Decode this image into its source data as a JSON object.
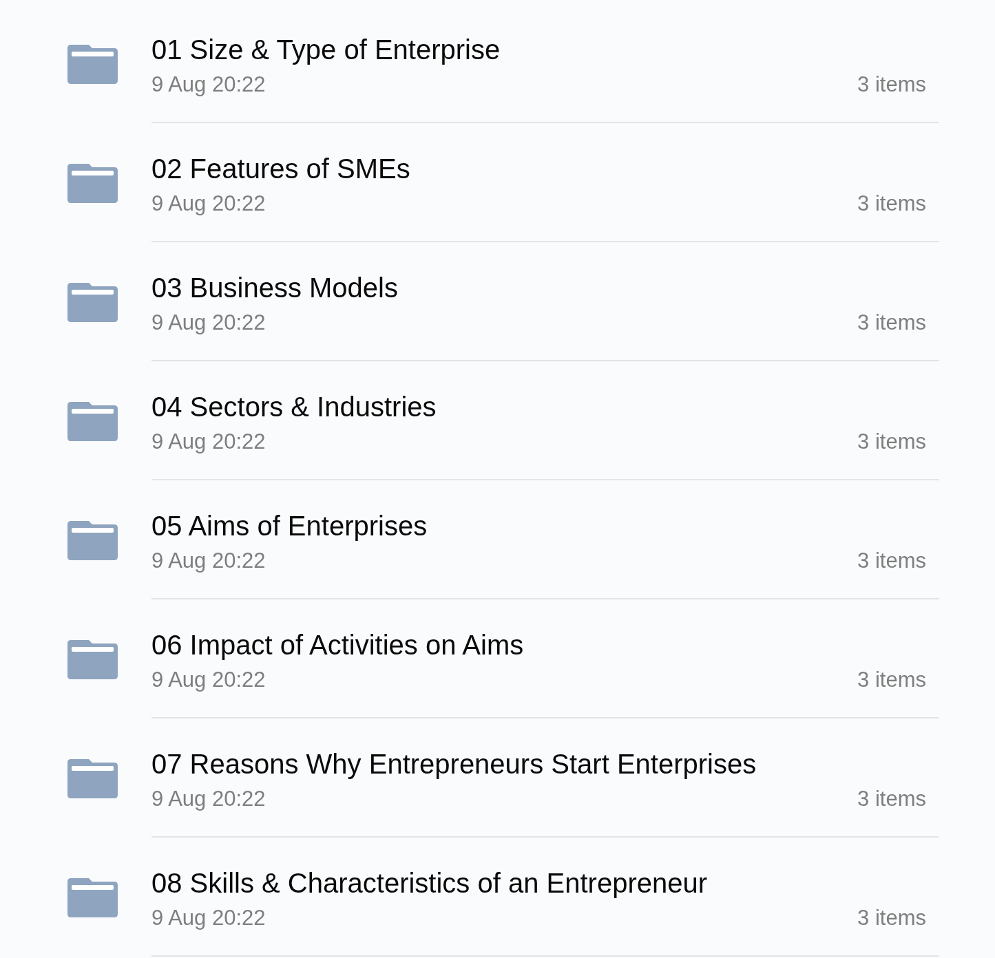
{
  "folders": [
    {
      "name": "01 Size & Type of Enterprise",
      "modified": "9 Aug 20:22",
      "count": "3 items"
    },
    {
      "name": "02 Features of SMEs",
      "modified": "9 Aug 20:22",
      "count": "3 items"
    },
    {
      "name": "03 Business Models",
      "modified": "9 Aug 20:22",
      "count": "3 items"
    },
    {
      "name": "04 Sectors & Industries",
      "modified": "9 Aug 20:22",
      "count": "3 items"
    },
    {
      "name": "05 Aims of Enterprises",
      "modified": "9 Aug 20:22",
      "count": "3 items"
    },
    {
      "name": "06 Impact of Activities on Aims",
      "modified": "9 Aug 20:22",
      "count": "3 items"
    },
    {
      "name": "07 Reasons Why Entrepreneurs Start Enterprises",
      "modified": "9 Aug 20:22",
      "count": "3 items"
    },
    {
      "name": "08 Skills & Characteristics of an Entrepreneur",
      "modified": "9 Aug 20:22",
      "count": "3 items"
    }
  ]
}
